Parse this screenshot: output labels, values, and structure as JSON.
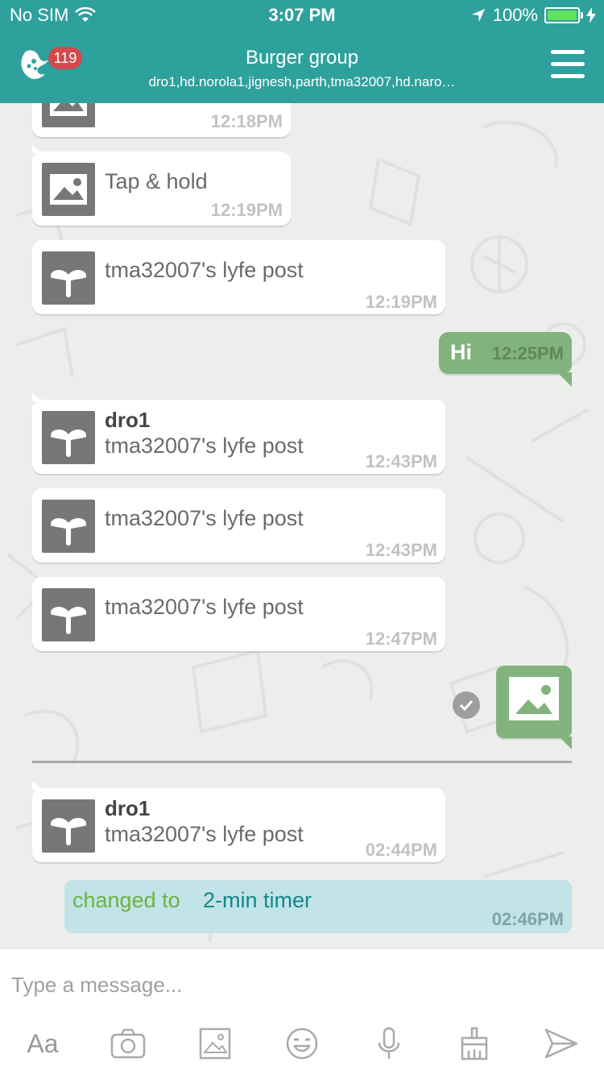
{
  "status_bar": {
    "carrier": "No SIM",
    "time": "3:07 PM",
    "battery": "100%"
  },
  "header": {
    "badge": "119",
    "title": "Burger group",
    "subtitle": "dro1,hd.norola1,jignesh,parth,tma32007,hd.naro…"
  },
  "messages": [
    {
      "time": "12:18PM"
    },
    {
      "text": "Tap & hold",
      "time": "12:19PM"
    },
    {
      "text": "tma32007's lyfe post",
      "time": "12:19PM"
    },
    {
      "text": "Hi",
      "time": "12:25PM"
    },
    {
      "sender": "dro1",
      "text": "tma32007's lyfe post",
      "time": "12:43PM"
    },
    {
      "text": "tma32007's lyfe post",
      "time": "12:43PM"
    },
    {
      "text": "tma32007's lyfe post",
      "time": "12:47PM"
    },
    {
      "sender": "dro1",
      "text": "tma32007's lyfe post",
      "time": "02:44PM"
    }
  ],
  "timer_notice": {
    "prefix": "changed to",
    "value": "2-min timer",
    "time": "02:46PM"
  },
  "composer": {
    "placeholder": "Type a message...",
    "font_button": "Aa",
    "tools": [
      "camera-icon",
      "gallery-icon",
      "emoji-icon",
      "microphone-icon",
      "brush-icon",
      "send-icon"
    ]
  },
  "colors": {
    "brand": "#2fa19c",
    "outgoing": "#82b37d",
    "badge": "#d3494e",
    "timer_bg": "#c2e3e7"
  }
}
